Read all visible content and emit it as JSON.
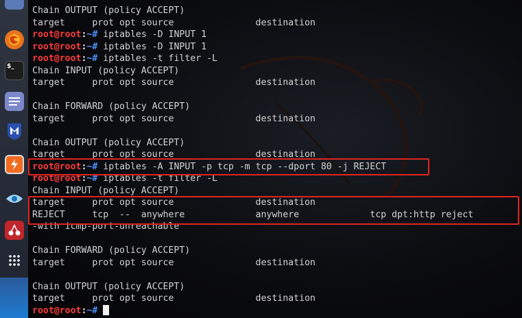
{
  "colors": {
    "prompt_user": "#ff3b3b",
    "prompt_path": "#4f8ff7",
    "output_text": "#d4d4d4",
    "highlight_box": "#e0251f",
    "background": "#0b0c10"
  },
  "dock": {
    "icons": [
      "file-manager-icon",
      "firefox-icon",
      "terminal-icon",
      "text-editor-icon",
      "metasploit-icon",
      "burpsuite-icon",
      "eye-icon",
      "cherrytree-icon",
      "app-grid-icon"
    ]
  },
  "terminal": {
    "prompt": {
      "user": "root@root",
      "sep": ":",
      "path": "~#"
    },
    "lines": [
      {
        "type": "output",
        "text": "Chain OUTPUT (policy ACCEPT)"
      },
      {
        "type": "output",
        "text": "target     prot opt source               destination"
      },
      {
        "type": "command",
        "cmd": " iptables -D INPUT 1"
      },
      {
        "type": "command",
        "cmd": " iptables -D INPUT 1"
      },
      {
        "type": "command",
        "cmd": " iptables -t filter -L"
      },
      {
        "type": "output",
        "text": "Chain INPUT (policy ACCEPT)"
      },
      {
        "type": "output",
        "text": "target     prot opt source               destination"
      },
      {
        "type": "output",
        "text": ""
      },
      {
        "type": "output",
        "text": "Chain FORWARD (policy ACCEPT)"
      },
      {
        "type": "output",
        "text": "target     prot opt source               destination"
      },
      {
        "type": "output",
        "text": ""
      },
      {
        "type": "output",
        "text": "Chain OUTPUT (policy ACCEPT)"
      },
      {
        "type": "output",
        "text": "target     prot opt source               destination"
      },
      {
        "type": "command",
        "cmd": " iptables -A INPUT -p tcp -m tcp --dport 80 -j REJECT"
      },
      {
        "type": "command",
        "cmd": " iptables -t filter -L"
      },
      {
        "type": "output",
        "text": "Chain INPUT (policy ACCEPT)"
      },
      {
        "type": "output",
        "text": "target     prot opt source               destination"
      },
      {
        "type": "output",
        "text": "REJECT     tcp  --  anywhere             anywhere             tcp dpt:http reject"
      },
      {
        "type": "output",
        "text": "-with icmp-port-unreachable"
      },
      {
        "type": "output",
        "text": ""
      },
      {
        "type": "output",
        "text": "Chain FORWARD (policy ACCEPT)"
      },
      {
        "type": "output",
        "text": "target     prot opt source               destination"
      },
      {
        "type": "output",
        "text": ""
      },
      {
        "type": "output",
        "text": "Chain OUTPUT (policy ACCEPT)"
      },
      {
        "type": "output",
        "text": "target     prot opt source               destination"
      },
      {
        "type": "prompt",
        "cmd": " "
      }
    ]
  }
}
